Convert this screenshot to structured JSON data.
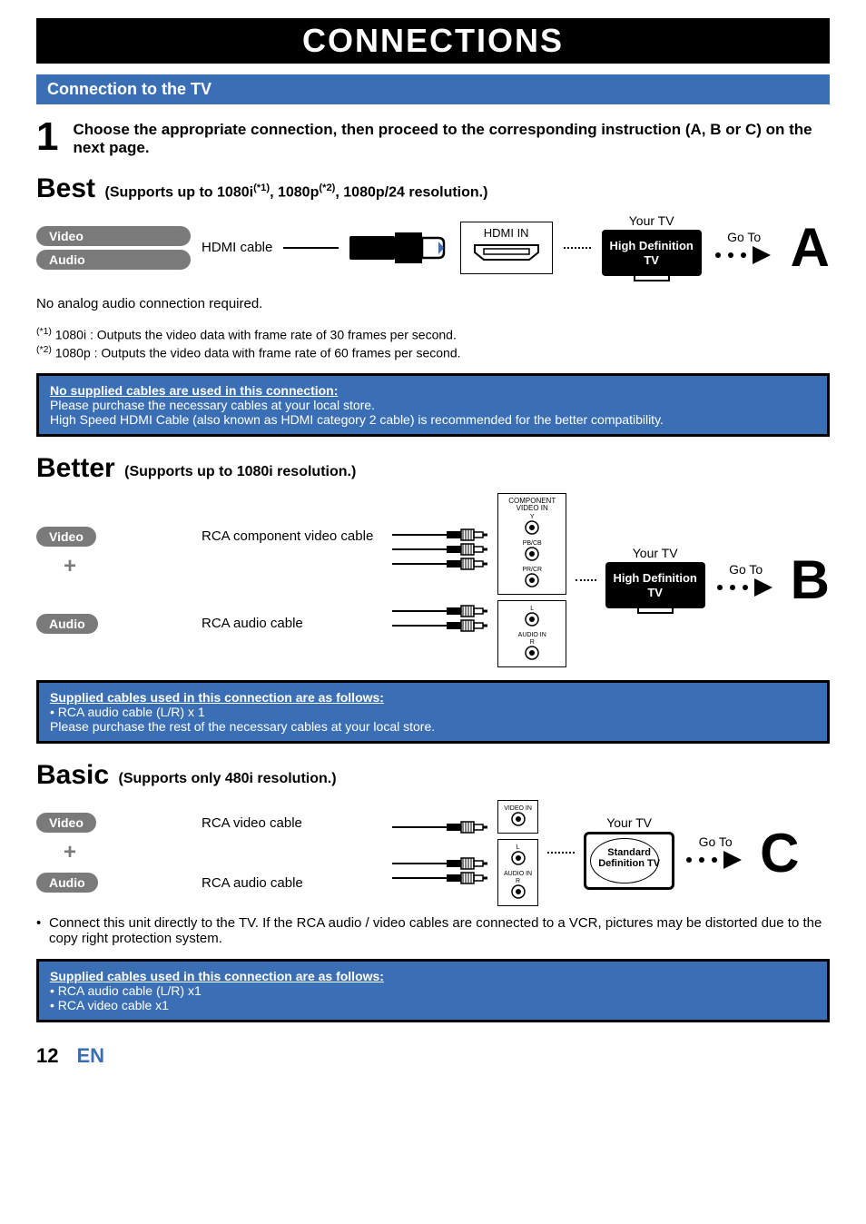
{
  "title": "CONNECTIONS",
  "section_header": "Connection to the TV",
  "step": {
    "number": "1",
    "text": "Choose the appropriate connection, then proceed to the corresponding instruction (A, B or C) on the next page."
  },
  "best": {
    "name": "Best",
    "desc_pre": "(Supports up to 1080i",
    "sup1": "(*1)",
    "desc_mid1": ", 1080p",
    "sup2": "(*2)",
    "desc_post": ", 1080p/24 resolution.)",
    "video_pill": "Video",
    "audio_pill": "Audio",
    "cable": "HDMI cable",
    "port_label": "HDMI IN",
    "tv_label": "Your TV",
    "tv_text": "High Definition TV",
    "goto": "Go To",
    "letter": "A",
    "note": "No analog audio connection required.",
    "fn1_sup": "(*1)",
    "fn1": " 1080i  : Outputs the video data with frame rate of 30 frames per second.",
    "fn2_sup": "(*2)",
    "fn2": " 1080p : Outputs the video data with frame rate of 60 frames per second.",
    "info_title": "No supplied cables are used in this connection:",
    "info_line1": "Please purchase the necessary cables at your local store.",
    "info_line2": "High Speed HDMI Cable (also known as HDMI category 2 cable) is recommended for the better compatibility."
  },
  "better": {
    "name": "Better",
    "desc": "(Supports up to 1080i resolution.)",
    "video_pill": "Video",
    "audio_pill": "Audio",
    "video_cable": "RCA component video cable",
    "audio_cable": "RCA audio cable",
    "port_header": "COMPONENT VIDEO IN",
    "port_y": "Y",
    "port_pb": "PB/CB",
    "port_pr": "PR/CR",
    "audio_l": "L",
    "audio_in": "AUDIO IN",
    "audio_r": "R",
    "tv_label": "Your TV",
    "tv_text": "High Definition TV",
    "goto": "Go To",
    "letter": "B",
    "info_title": "Supplied cables used in this connection are as follows:",
    "info_line1": "• RCA audio cable (L/R) x 1",
    "info_line2": "Please purchase the rest of the necessary cables at your local store."
  },
  "basic": {
    "name": "Basic",
    "desc": "(Supports only 480i resolution.)",
    "video_pill": "Video",
    "audio_pill": "Audio",
    "video_cable": "RCA video cable",
    "audio_cable": "RCA audio cable",
    "video_in": "VIDEO IN",
    "audio_l": "L",
    "audio_in": "AUDIO IN",
    "audio_r": "R",
    "tv_label": "Your TV",
    "tv_text": "Standard Definition TV",
    "goto": "Go To",
    "letter": "C",
    "bullet": "Connect this unit directly to the TV. If the RCA audio / video cables are connected to a VCR, pictures may be distorted due to the copy right protection system.",
    "info_title": "Supplied cables used in this connection are as follows:",
    "info_line1": "• RCA audio cable (L/R) x1",
    "info_line2": "• RCA video cable x1"
  },
  "footer": {
    "page": "12",
    "lang": "EN"
  }
}
